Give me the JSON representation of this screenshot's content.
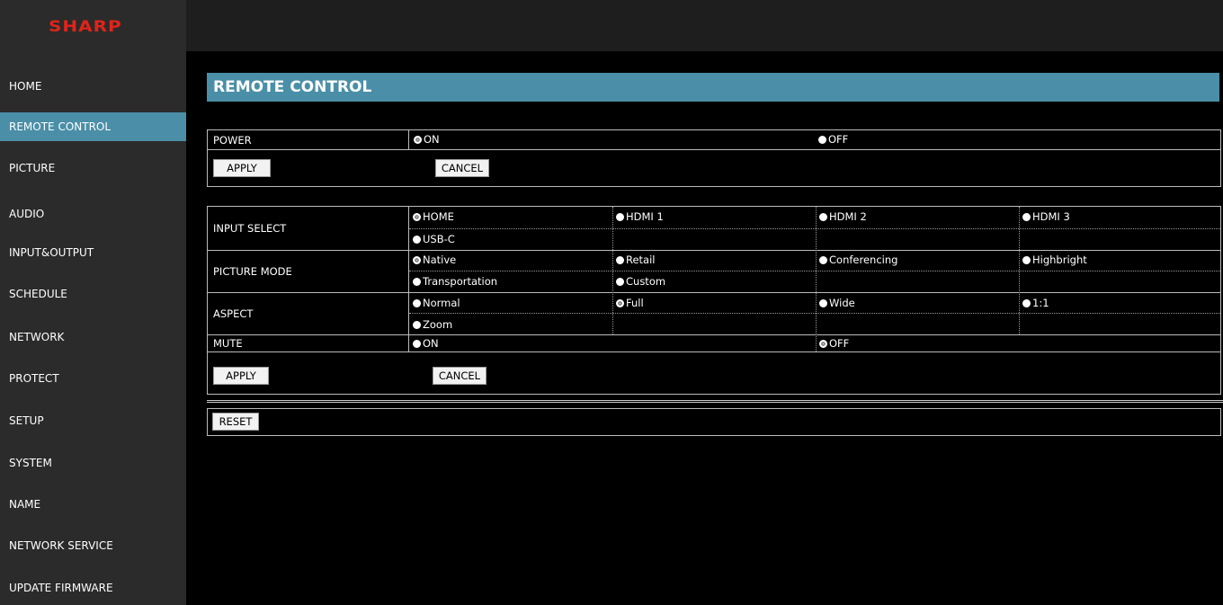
{
  "logo": "SHARP",
  "nav": [
    "HOME",
    "REMOTE CONTROL",
    "PICTURE",
    "AUDIO",
    "INPUT&OUTPUT",
    "SCHEDULE",
    "NETWORK",
    "PROTECT",
    "SETUP",
    "SYSTEM",
    "NAME",
    "NETWORK SERVICE",
    "UPDATE FIRMWARE"
  ],
  "nav_active": "REMOTE CONTROL",
  "page_title": "REMOTE CONTROL",
  "power": {
    "label": "POWER",
    "options": [
      "ON",
      "OFF"
    ],
    "selected": "ON",
    "apply": "APPLY",
    "cancel": "CANCEL"
  },
  "input_select": {
    "label": "INPUT SELECT",
    "options": [
      "HOME",
      "HDMI 1",
      "HDMI 2",
      "HDMI 3",
      "USB-C"
    ],
    "selected": "HOME"
  },
  "picture_mode": {
    "label": "PICTURE MODE",
    "options": [
      "Native",
      "Retail",
      "Conferencing",
      "Highbright",
      "Transportation",
      "Custom"
    ],
    "selected": "Native"
  },
  "aspect": {
    "label": "ASPECT",
    "options": [
      "Normal",
      "Full",
      "Wide",
      "1:1",
      "Zoom"
    ],
    "selected": "Full"
  },
  "mute": {
    "label": "MUTE",
    "options": [
      "ON",
      "OFF"
    ],
    "selected": "OFF"
  },
  "settings_apply": "APPLY",
  "settings_cancel": "CANCEL",
  "reset": "RESET",
  "colors": {
    "accent": "#4a8fa7",
    "sidebar": "#2b2b2b",
    "logo": "#e2231a"
  }
}
